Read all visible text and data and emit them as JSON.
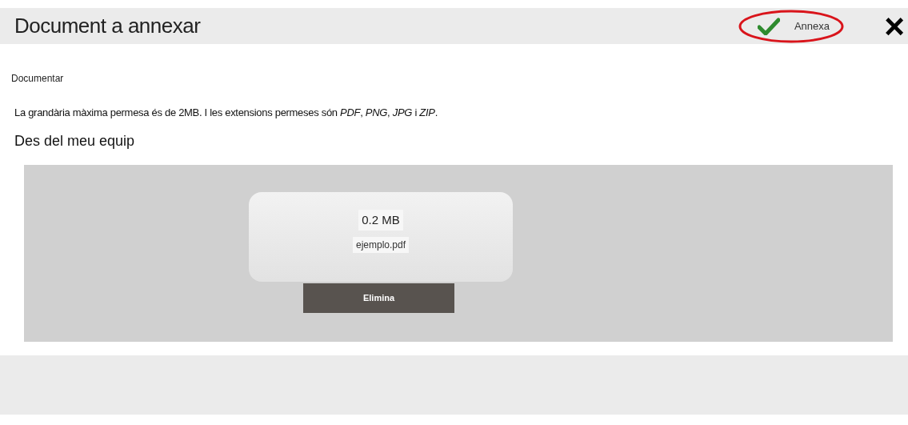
{
  "header": {
    "title": "Document a annexar",
    "confirm_button": "Annexa",
    "close_button": "×",
    "confirm_highlighted": true
  },
  "section_label": "Documentar",
  "info": "La grandària màxima permesa és de 2MB. I les extensions permeses són *PDF*, *PNG*, *JPG* i *ZIP*.",
  "source_heading": "Des del meu equip",
  "files": [
    {
      "size": "0.2 MB",
      "name": "ejemplo.pdf",
      "remove_button": "Elimina"
    }
  ]
}
